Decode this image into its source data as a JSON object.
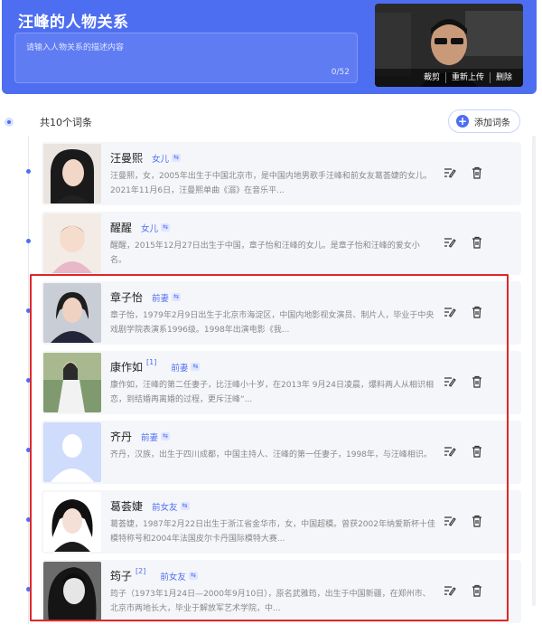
{
  "header": {
    "title": "汪峰的人物关系",
    "description_placeholder": "请输入人物关系的描述内容",
    "counter": "0/52",
    "cover_actions": [
      "裁剪",
      "重新上传",
      "删除"
    ]
  },
  "list": {
    "count_label": "共10个词条",
    "add_button_label": "添加词条",
    "entries": [
      {
        "name": "汪曼熙",
        "sup": "",
        "relation": "女儿",
        "desc": "汪曼熙，女，2005年出生于中国北京市，是中国内地男歌手汪峰和前女友葛荟婕的女儿。2021年11月6日，汪曼熙单曲《溺》在音乐平..."
      },
      {
        "name": "醒醒",
        "sup": "",
        "relation": "女儿",
        "desc": "醒醒，2015年12月27日出生于中国，章子怡和汪峰的女儿。是章子怡和汪峰的爱女小名。"
      },
      {
        "name": "章子怡",
        "sup": "",
        "relation": "前妻",
        "desc": "章子怡，1979年2月9日出生于北京市海淀区，中国内地影视女演员、制片人，毕业于中央戏剧学院表演系1996级。1998年出演电影《我..."
      },
      {
        "name": "康作如",
        "sup": "[1]",
        "relation": "前妻",
        "desc": "康作如，汪峰的第二任妻子，比汪峰小十岁，在2013年 9月24日凌晨，爆料两人从相识相恋，到结婚再离婚的过程，更斥汪峰“..."
      },
      {
        "name": "齐丹",
        "sup": "",
        "relation": "前妻",
        "desc": "齐丹，汉族，出生于四川成都，中国主持人、汪峰的第一任妻子，1998年，与汪峰相识。"
      },
      {
        "name": "葛荟婕",
        "sup": "",
        "relation": "前女友",
        "desc": "葛荟婕，1987年2月22日出生于浙江省金华市，女，中国超模。曾获2002年纳爱斯杯十佳模特称号和2004年法国皮尔卡丹国际模特大赛..."
      },
      {
        "name": "筠子",
        "sup": "[2]",
        "relation": "前女友",
        "desc": "筠子（1973年1月24日—2000年9月10日），原名武雅筠，出生于中国新疆，在郑州市、北京市两地长大，毕业于解放军艺术学院，中..."
      }
    ]
  },
  "colors": {
    "accent": "#4e6ef2",
    "highlight_border": "#e0262a",
    "row_background": "#f5f6f9"
  },
  "icons": [
    "add-icon",
    "edit-icon",
    "delete-icon",
    "default-avatar-icon",
    "relation-tag-icon"
  ]
}
